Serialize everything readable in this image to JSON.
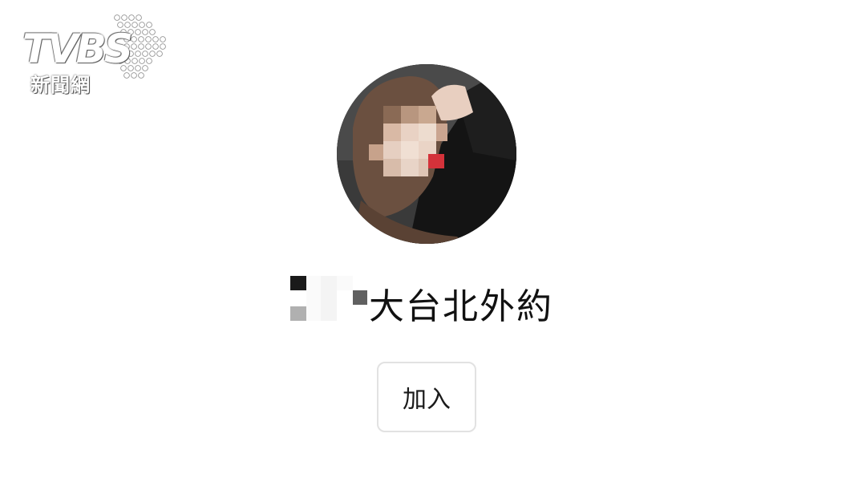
{
  "watermark": {
    "logo_text": "TVBS",
    "logo_subtitle": "新聞網"
  },
  "group": {
    "name_visible": "大台北外約",
    "join_label": "加入"
  },
  "colors": {
    "background": "#ffffff",
    "text": "#111111",
    "button_border": "#e2e2e2"
  }
}
